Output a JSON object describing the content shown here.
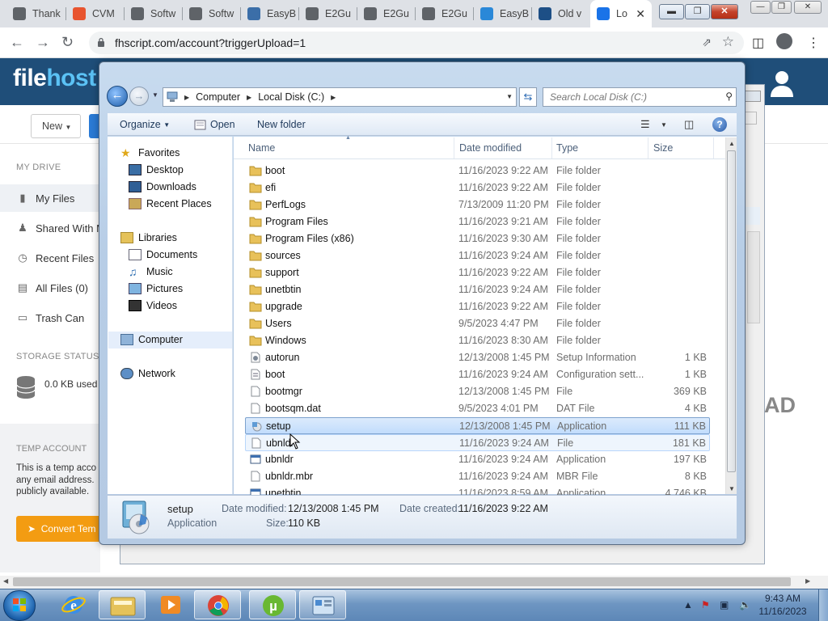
{
  "browser": {
    "tabs": [
      {
        "label": "Thank",
        "color": "#5f6368"
      },
      {
        "label": "CVM",
        "color": "#e8542f"
      },
      {
        "label": "Softw",
        "color": "#5f6368"
      },
      {
        "label": "Softw",
        "color": "#5f6368"
      },
      {
        "label": "EasyB",
        "color": "#3b6ea8"
      },
      {
        "label": "E2Gu",
        "color": "#5f6368"
      },
      {
        "label": "E2Gu",
        "color": "#5f6368"
      },
      {
        "label": "E2Gu",
        "color": "#5f6368"
      },
      {
        "label": "EasyB",
        "color": "#2a88d8"
      },
      {
        "label": "Old v",
        "color": "#1d4f86"
      },
      {
        "label": "Lo",
        "color": "#1a73e8"
      }
    ],
    "url": "fhscript.com/account?triggerUpload=1"
  },
  "site": {
    "logo_part1": "file",
    "logo_part2": "host",
    "new_button": "New",
    "section_my_drive": "MY DRIVE",
    "menu": [
      "My Files",
      "Shared With M",
      "Recent Files",
      "All Files (0)",
      "Trash Can"
    ],
    "section_storage": "STORAGE STATUS",
    "storage_used": "0.0 KB used",
    "section_temp": "TEMP ACCOUNT",
    "temp_text": [
      "This is a temp acco",
      "any email address.",
      "publicly available."
    ],
    "convert_button": "Convert Tem",
    "ad_text": "AD"
  },
  "dialog": {
    "breadcrumb": [
      "Computer",
      "Local Disk (C:)"
    ],
    "search_placeholder": "Search Local Disk (C:)",
    "commands": {
      "organize": "Organize",
      "open": "Open",
      "new_folder": "New folder"
    },
    "nav": {
      "favorites": "Favorites",
      "favorites_items": [
        "Desktop",
        "Downloads",
        "Recent Places"
      ],
      "libraries": "Libraries",
      "libraries_items": [
        "Documents",
        "Music",
        "Pictures",
        "Videos"
      ],
      "computer": "Computer",
      "network": "Network"
    },
    "columns": {
      "name": "Name",
      "date": "Date modified",
      "type": "Type",
      "size": "Size"
    },
    "files": [
      {
        "name": "boot",
        "date": "11/16/2023 9:22 AM",
        "type": "File folder",
        "size": "",
        "kind": "folder"
      },
      {
        "name": "efi",
        "date": "11/16/2023 9:22 AM",
        "type": "File folder",
        "size": "",
        "kind": "folder"
      },
      {
        "name": "PerfLogs",
        "date": "7/13/2009 11:20 PM",
        "type": "File folder",
        "size": "",
        "kind": "folder"
      },
      {
        "name": "Program Files",
        "date": "11/16/2023 9:21 AM",
        "type": "File folder",
        "size": "",
        "kind": "folder"
      },
      {
        "name": "Program Files (x86)",
        "date": "11/16/2023 9:30 AM",
        "type": "File folder",
        "size": "",
        "kind": "folder"
      },
      {
        "name": "sources",
        "date": "11/16/2023 9:24 AM",
        "type": "File folder",
        "size": "",
        "kind": "folder"
      },
      {
        "name": "support",
        "date": "11/16/2023 9:22 AM",
        "type": "File folder",
        "size": "",
        "kind": "folder"
      },
      {
        "name": "unetbtin",
        "date": "11/16/2023 9:24 AM",
        "type": "File folder",
        "size": "",
        "kind": "folder"
      },
      {
        "name": "upgrade",
        "date": "11/16/2023 9:22 AM",
        "type": "File folder",
        "size": "",
        "kind": "folder"
      },
      {
        "name": "Users",
        "date": "9/5/2023 4:47 PM",
        "type": "File folder",
        "size": "",
        "kind": "folder"
      },
      {
        "name": "Windows",
        "date": "11/16/2023 8:30 AM",
        "type": "File folder",
        "size": "",
        "kind": "folder"
      },
      {
        "name": "autorun",
        "date": "12/13/2008 1:45 PM",
        "type": "Setup Information",
        "size": "1 KB",
        "kind": "setupinfo"
      },
      {
        "name": "boot",
        "date": "11/16/2023 9:24 AM",
        "type": "Configuration sett...",
        "size": "1 KB",
        "kind": "config"
      },
      {
        "name": "bootmgr",
        "date": "12/13/2008 1:45 PM",
        "type": "File",
        "size": "369 KB",
        "kind": "file"
      },
      {
        "name": "bootsqm.dat",
        "date": "9/5/2023 4:01 PM",
        "type": "DAT File",
        "size": "4 KB",
        "kind": "file"
      },
      {
        "name": "setup",
        "date": "12/13/2008 1:45 PM",
        "type": "Application",
        "size": "111 KB",
        "kind": "setup",
        "state": "selected"
      },
      {
        "name": "ubnldr",
        "date": "11/16/2023 9:24 AM",
        "type": "File",
        "size": "181 KB",
        "kind": "file",
        "state": "hover"
      },
      {
        "name": "ubnldr",
        "date": "11/16/2023 9:24 AM",
        "type": "Application",
        "size": "197 KB",
        "kind": "app"
      },
      {
        "name": "ubnldr.mbr",
        "date": "11/16/2023 9:24 AM",
        "type": "MBR File",
        "size": "8 KB",
        "kind": "file"
      },
      {
        "name": "unetbtin",
        "date": "11/16/2023 8:59 AM",
        "type": "Application",
        "size": "4,746 KB",
        "kind": "app"
      }
    ],
    "details": {
      "name": "setup",
      "type": "Application",
      "modified_label": "Date modified:",
      "modified": "12/13/2008 1:45 PM",
      "created_label": "Date created:",
      "created": "11/16/2023 9:22 AM",
      "size_label": "Size:",
      "size": "110 KB"
    }
  },
  "taskbar": {
    "time": "9:43 AM",
    "date": "11/16/2023"
  }
}
